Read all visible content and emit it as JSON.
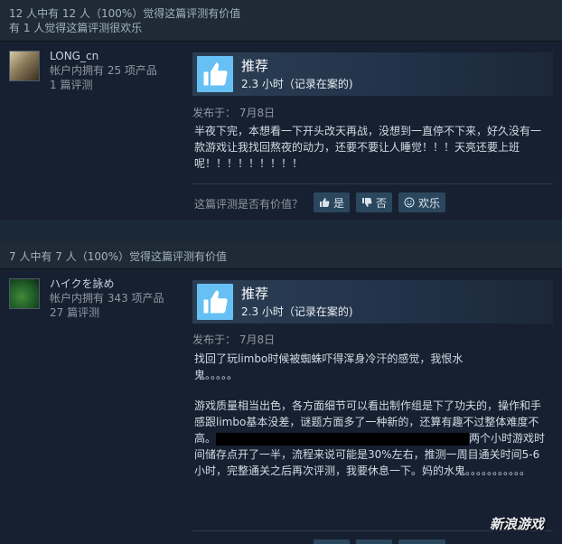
{
  "reviews": [
    {
      "helpful_line1": "12 人中有 12 人（100%）觉得这篇评测有价值",
      "helpful_line2": "有 1 人觉得这篇评测很欢乐",
      "user_name": "LONG_cn",
      "products_owned": "帐户内拥有 25 项产品",
      "review_count": "1 篇评测",
      "recommend": "推荐",
      "hours": "2.3 小时（记录在案的)",
      "posted": "发布于：  7月8日",
      "text": "半夜下完，本想看一下开头改天再战，没想到一直停不下来，好久没有一款游戏让我找回熬夜的动力，还要不要让人睡觉！！！天亮还要上班呢！！！！！！！！！"
    },
    {
      "helpful_line1": "7 人中有 7 人（100%）觉得这篇评测有价值",
      "user_name": "ハイクを詠め",
      "products_owned": "帐户内拥有 343 项产品",
      "review_count": "27 篇评测",
      "recommend": "推荐",
      "hours": "2.3 小时（记录在案的)",
      "posted": "发布于：  7月8日",
      "text_p1": "找回了玩limbo时候被蜘蛛吓得浑身冷汗的感觉，我恨水鬼。。。。。",
      "text_p2a": "游戏质量相当出色，各方面细节可以看出制作组是下了功夫的，操作和手感跟limbo基本没差，谜题方面多了一种新的，还算有趣不过整体难度不高。",
      "text_p2b": "两个小时游戏时间储存点开了一半，流程来说可能是30%左右，推测一周目通关时间5-6小时，完整通关之后再次评测，我要休息一下。妈的水鬼。。。。。。。。。。。"
    }
  ],
  "helpful_question": "这篇评测是否有价值？",
  "vote_yes": "是",
  "vote_no": "否",
  "vote_funny": "欢乐",
  "watermark": "新浪游戏",
  "colors": {
    "background": "#1b2838",
    "accent": "#66c0f4",
    "button": "#2a475e"
  }
}
